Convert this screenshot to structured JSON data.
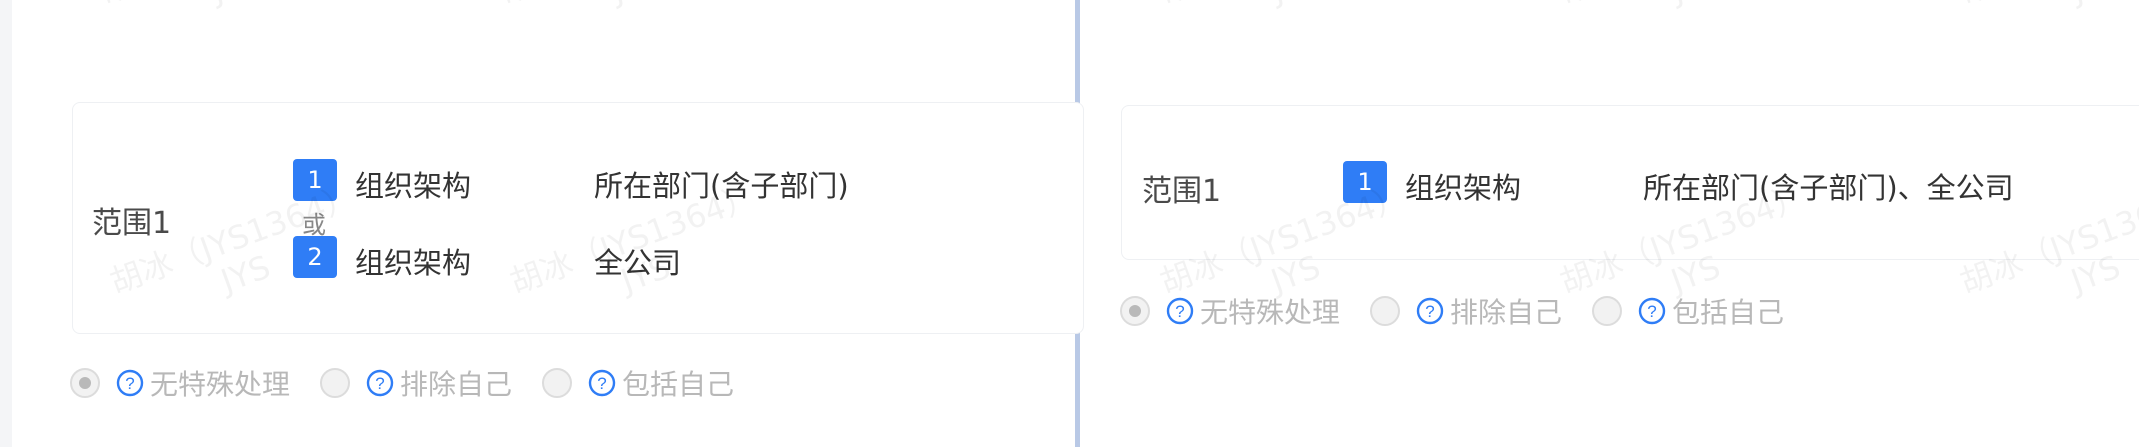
{
  "left_panel": {
    "range_label": "范围1",
    "rows": [
      {
        "index": "1",
        "category": "组织架构",
        "value": "所在部门(含子部门)"
      },
      {
        "index": "2",
        "category": "组织架构",
        "value": "全公司"
      }
    ],
    "connector": "或",
    "options": [
      {
        "label": "无特殊处理",
        "selected": true
      },
      {
        "label": "排除自己",
        "selected": false
      },
      {
        "label": "包括自己",
        "selected": false
      }
    ]
  },
  "right_panel": {
    "range_label": "范围1",
    "rows": [
      {
        "index": "1",
        "category": "组织架构",
        "value": "所在部门(含子部门)、全公司"
      }
    ],
    "options": [
      {
        "label": "无特殊处理",
        "selected": true
      },
      {
        "label": "排除自己",
        "selected": false
      },
      {
        "label": "包括自己",
        "selected": false
      }
    ]
  },
  "watermark": {
    "line1": "胡冰（JYS1364）",
    "line2": "JYS"
  },
  "colors": {
    "accent": "#2f7df6",
    "divider": "#b9c9e6",
    "disabled_text": "#b8b8b8"
  }
}
